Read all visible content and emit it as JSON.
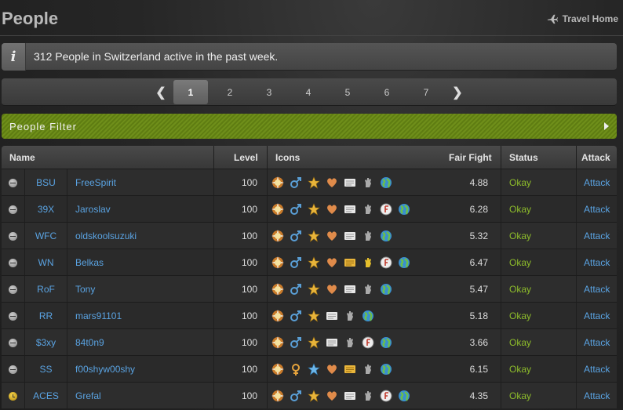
{
  "header": {
    "title": "People",
    "travel_label": "Travel Home"
  },
  "info": {
    "text": "312 People in Switzerland active in the past week."
  },
  "pagination": {
    "prev": "❮",
    "next": "❯",
    "pages": [
      "1",
      "2",
      "3",
      "4",
      "5",
      "6",
      "7"
    ],
    "active": "1"
  },
  "filter": {
    "label": "People Filter"
  },
  "table": {
    "columns": {
      "name": "Name",
      "level": "Level",
      "icons": "Icons",
      "fair_fight": "Fair Fight",
      "status": "Status",
      "attack": "Attack"
    },
    "rows": [
      {
        "online": "idle-gray",
        "faction": "BSU",
        "name": "FreeSpirit",
        "level": "100",
        "icons": [
          "sun-badge-icon",
          "male-icon",
          "star-icon",
          "heart-icon",
          "document-icon",
          "fist-icon",
          "globe-icon"
        ],
        "fair_fight": "4.88",
        "status": "Okay",
        "attack": "Attack"
      },
      {
        "online": "idle-gray",
        "faction": "39X",
        "name": "Jaroslav",
        "level": "100",
        "icons": [
          "sun-badge-icon",
          "male-icon",
          "star-icon",
          "heart-icon",
          "document-icon",
          "fist-icon",
          "clock-badge-icon",
          "globe-icon"
        ],
        "fair_fight": "6.28",
        "status": "Okay",
        "attack": "Attack"
      },
      {
        "online": "idle-gray",
        "faction": "WFC",
        "name": "oldskoolsuzuki",
        "level": "100",
        "icons": [
          "sun-badge-icon",
          "male-icon",
          "star-icon",
          "heart-icon",
          "document-icon",
          "fist-icon",
          "globe-icon"
        ],
        "fair_fight": "5.32",
        "status": "Okay",
        "attack": "Attack"
      },
      {
        "online": "idle-gray",
        "faction": "WN",
        "name": "Belkas",
        "level": "100",
        "icons": [
          "sun-badge-icon",
          "male-icon",
          "star-icon",
          "heart-icon",
          "document-yellow-icon",
          "fist-yellow-icon",
          "clock-badge-icon",
          "globe-icon"
        ],
        "fair_fight": "6.47",
        "status": "Okay",
        "attack": "Attack"
      },
      {
        "online": "idle-gray",
        "faction": "RoF",
        "name": "Tony",
        "level": "100",
        "icons": [
          "sun-badge-icon",
          "male-icon",
          "star-icon",
          "heart-icon",
          "document-icon",
          "fist-icon",
          "globe-icon"
        ],
        "fair_fight": "5.47",
        "status": "Okay",
        "attack": "Attack"
      },
      {
        "online": "idle-gray",
        "faction": "RR",
        "name": "mars91101",
        "level": "100",
        "icons": [
          "sun-badge-icon",
          "male-icon",
          "star-icon",
          "document-icon",
          "fist-icon",
          "globe-icon"
        ],
        "fair_fight": "5.18",
        "status": "Okay",
        "attack": "Attack"
      },
      {
        "online": "idle-gray",
        "faction": "$3xy",
        "name": "84t0n9",
        "level": "100",
        "icons": [
          "sun-badge-icon",
          "male-icon",
          "star-icon",
          "document-icon",
          "fist-icon",
          "clock-badge-icon",
          "globe-icon"
        ],
        "fair_fight": "3.66",
        "status": "Okay",
        "attack": "Attack"
      },
      {
        "online": "idle-gray",
        "faction": "SS",
        "name": "f00shyw00shy",
        "level": "100",
        "icons": [
          "sun-badge-icon",
          "female-icon",
          "star-blue-icon",
          "heart-icon",
          "document-yellow-icon",
          "fist-icon",
          "globe-icon"
        ],
        "fair_fight": "6.15",
        "status": "Okay",
        "attack": "Attack"
      },
      {
        "online": "idle-yellow",
        "faction": "ACES",
        "name": "Grefal",
        "level": "100",
        "icons": [
          "sun-badge-icon",
          "male-icon",
          "star-icon",
          "heart-icon",
          "document-icon",
          "fist-icon",
          "clock-badge-icon",
          "globe-icon"
        ],
        "fair_fight": "4.35",
        "status": "Okay",
        "attack": "Attack"
      }
    ]
  },
  "colors": {
    "accent_green": "#8ebd2b",
    "link_blue": "#5aa3e2",
    "filter_green": "#6f8f1a"
  }
}
